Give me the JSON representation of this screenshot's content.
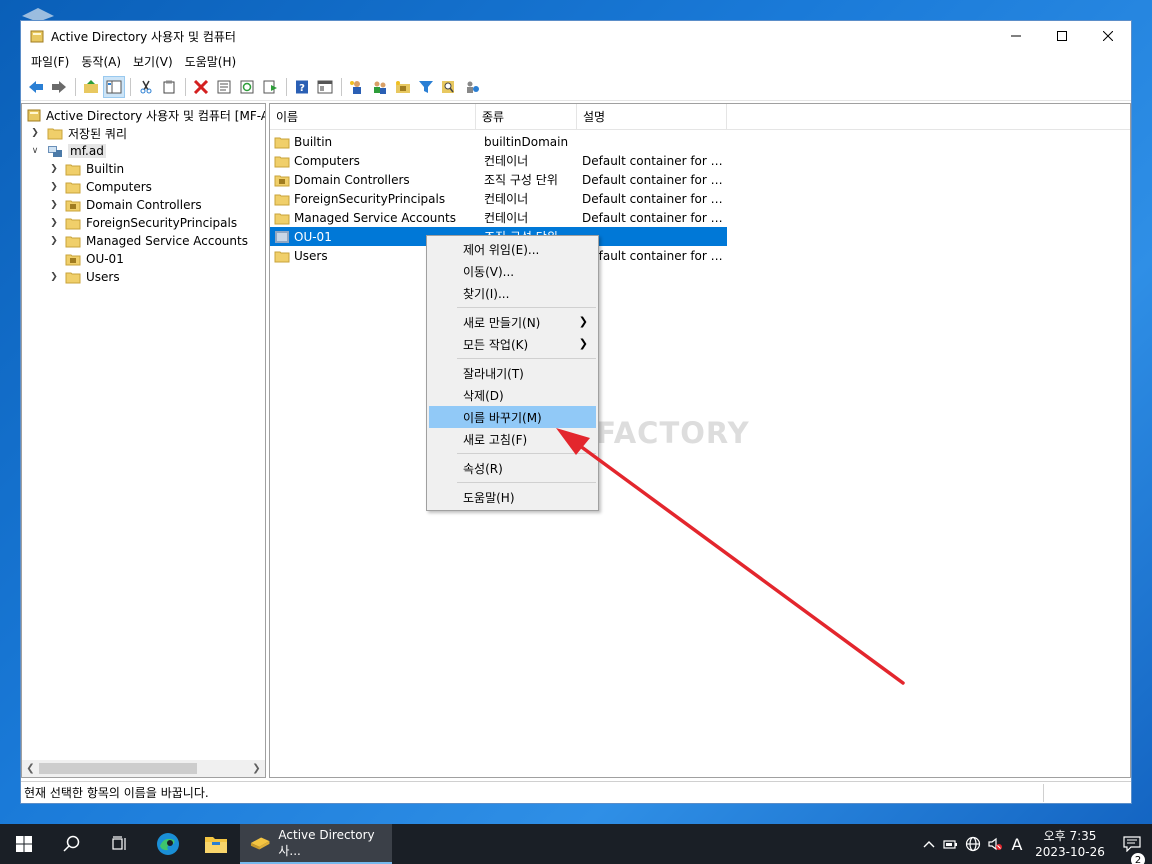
{
  "window": {
    "title": "Active Directory 사용자 및 컴퓨터",
    "controls": {
      "minimize": "—",
      "maximize": "☐",
      "close": "✕"
    }
  },
  "menubar": {
    "items": [
      "파일(F)",
      "동작(A)",
      "보기(V)",
      "도움말(H)"
    ]
  },
  "toolbar": {
    "icons": [
      "back-arrow-icon",
      "forward-arrow-icon",
      "up-folder-icon",
      "show-tree-icon",
      "cut-icon",
      "copy-icon",
      "delete-icon",
      "properties-icon",
      "refresh-icon",
      "export-list-icon",
      "help-icon",
      "view-icon",
      "new-user-icon",
      "new-group-icon",
      "new-ou-icon",
      "filter-icon",
      "find-icon",
      "add-to-group-icon"
    ]
  },
  "tree": {
    "root": "Active Directory 사용자 및 컴퓨터 [MF-AD",
    "saved_queries": "저장된 쿼리",
    "domain": "mf.ad",
    "children": [
      "Builtin",
      "Computers",
      "Domain Controllers",
      "ForeignSecurityPrincipals",
      "Managed Service Accounts",
      "OU-01",
      "Users"
    ]
  },
  "list": {
    "columns": [
      "이름",
      "종류",
      "설명"
    ],
    "rows": [
      {
        "name": "Builtin",
        "type": "builtinDomain",
        "desc": ""
      },
      {
        "name": "Computers",
        "type": "컨테이너",
        "desc": "Default container for u..."
      },
      {
        "name": "Domain Controllers",
        "type": "조직 구성 단위",
        "desc": "Default container for d..."
      },
      {
        "name": "ForeignSecurityPrincipals",
        "type": "컨테이너",
        "desc": "Default container for se..."
      },
      {
        "name": "Managed Service Accounts",
        "type": "컨테이너",
        "desc": "Default container for m..."
      },
      {
        "name": "OU-01",
        "type": "조직 구성 단위",
        "desc": ""
      },
      {
        "name": "Users",
        "type": "컨테이너",
        "desc": "Default container for u..."
      }
    ]
  },
  "context_menu": {
    "items": [
      "제어 위임(E)...",
      "이동(V)...",
      "찾기(I)...",
      "새로 만들기(N)",
      "모든 작업(K)",
      "잘라내기(T)",
      "삭제(D)",
      "이름 바꾸기(M)",
      "새로 고침(F)",
      "속성(R)",
      "도움말(H)"
    ],
    "highlighted": "이름 바꾸기(M)"
  },
  "watermark": "MANUAL FACTORY",
  "status": "현재 선택한 항목의 이름을 바꿉니다.",
  "taskbar": {
    "app_label": "Active Directory 사...",
    "ime": "A",
    "time": "오후 7:35",
    "date": "2023-10-26",
    "notifications": "2"
  },
  "colors": {
    "selection": "#0078d7",
    "menu_hover": "#91c9f7",
    "arrow": "#e3262d",
    "taskbar": "#1a1f26"
  }
}
